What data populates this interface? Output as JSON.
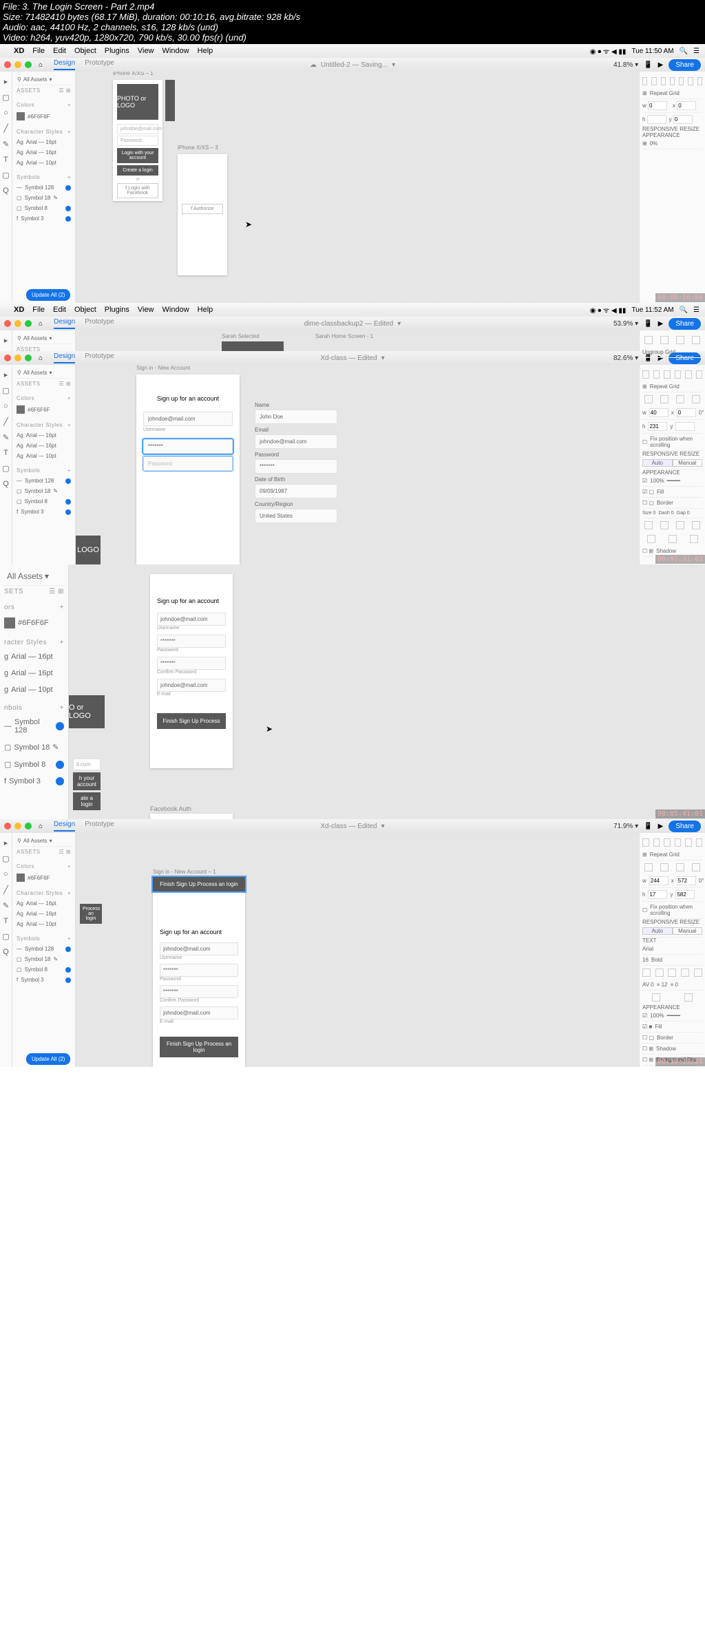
{
  "file_info": {
    "l1": "File: 3. The Login Screen - Part 2.mp4",
    "l2": "Size: 71482410 bytes (68.17 MiB), duration: 00:10:16, avg.bitrate: 928 kb/s",
    "l3": "Audio: aac, 44100 Hz, 2 channels, s16, 128 kb/s (und)",
    "l4": "Video: h264, yuv420p, 1280x720, 790 kb/s, 30.00 fps(r) (und)"
  },
  "menu": {
    "app": "XD",
    "file": "File",
    "edit": "Edit",
    "object": "Object",
    "plugins": "Plugins",
    "view": "View",
    "window": "Window",
    "help": "Help"
  },
  "clock": {
    "t1": "Tue 11:50 AM",
    "t2": "Tue 11:52 AM"
  },
  "tabs": {
    "design": "Design",
    "prototype": "Prototype"
  },
  "docs": {
    "d1": "Untitled-2 — Saving...",
    "d2": "dime-classbackup2 — Edited",
    "d3": "Xd-class — Edited",
    "d4": "Xd-class — Edited"
  },
  "zoom": {
    "z1": "41.8%",
    "z2": "53.9%",
    "z3": "82.6%",
    "z4": "71.9%"
  },
  "share": "Share",
  "assets": {
    "search": "All Assets",
    "hdr": "ASSETS",
    "colors_hdr": "Colors",
    "color1": "#6F6F6F",
    "char_hdr": "Character Styles",
    "arial16": "Arial — 16pt",
    "arial10": "Arial — 10pt",
    "symbols_hdr": "Symbols",
    "sym128": "Symbol 128",
    "sym18": "Symbol 18",
    "sym8": "Symbol 8",
    "sym3": "Symbol 3"
  },
  "artboards": {
    "ab1": "iPhone X/XS – 1",
    "ab3": "iPhone X/XS – 3",
    "signin": "Sign in - New Account",
    "signin1": "Sign in - New Account – 1",
    "sarah_sel": "Sarah Selected",
    "sarah_home": "Sarah Home Screen - 1",
    "fb": "Facebook Auth"
  },
  "login1": {
    "logo": "PHOTO or LOGO",
    "email": "johndoe@mail.com",
    "pwd": "Password",
    "btn1": "Login with your account",
    "btn2": "Create a login",
    "or": "or",
    "fb": "Login with Facebook",
    "auth": "Authorize"
  },
  "signup": {
    "title": "Sign up for an account",
    "email": "johndoe@mail.com",
    "userlabel": "Username",
    "dots": "*******",
    "pwdlabel": "Password",
    "confirmlabel": "Confirm Password",
    "emaillabel": "E-mail",
    "finish": "Finish Sign Up Process",
    "finish2": "Finish Sign Up Process an login"
  },
  "form": {
    "name": "Name",
    "name_v": "John Doe",
    "email": "Email",
    "email_v": "johndoe@mail.com",
    "pwd": "Password",
    "pwd_v": "*******",
    "dob": "Date of Birth",
    "dob_v": "09/09/1987",
    "country": "Country/Region",
    "country_v": "United States"
  },
  "props": {
    "repeat": "Repeat Grid",
    "ungroup": "Ungroup Grid",
    "responsive": "RESPONSIVE RESIZE",
    "appearance": "APPEARANCE",
    "opacity": "0%",
    "opacity100": "100%",
    "fill": "Fill",
    "border": "Border",
    "shadow": "Shadow",
    "bgblur": "Background Blur",
    "fixpos": "Fix position when scrolling",
    "auto": "Auto",
    "manual": "Manual",
    "size": "Size 0",
    "dash": "Dash 0",
    "gap": "Gap 0",
    "text": "TEXT",
    "font": "Arial",
    "fsize": "16",
    "bold": "Bold",
    "w1": "244",
    "h1": "572",
    "x1": "17",
    "y1": "582",
    "w2": "40",
    "h2": "231",
    "rot": "0°"
  },
  "upd": {
    "all121": "Update All (2)",
    "all2": "Update All (2)"
  },
  "buttons": {
    "withacc": "h your account",
    "createlogin": "ate a login",
    "process": "Process an login"
  },
  "logo2": "LOGO",
  "logo3": "O or LOGO",
  "ts": {
    "t1": "00:00:16:08",
    "t2": "00:01:31:02",
    "t3": "00:05:41:01",
    "t4": "00:10:13:11"
  }
}
